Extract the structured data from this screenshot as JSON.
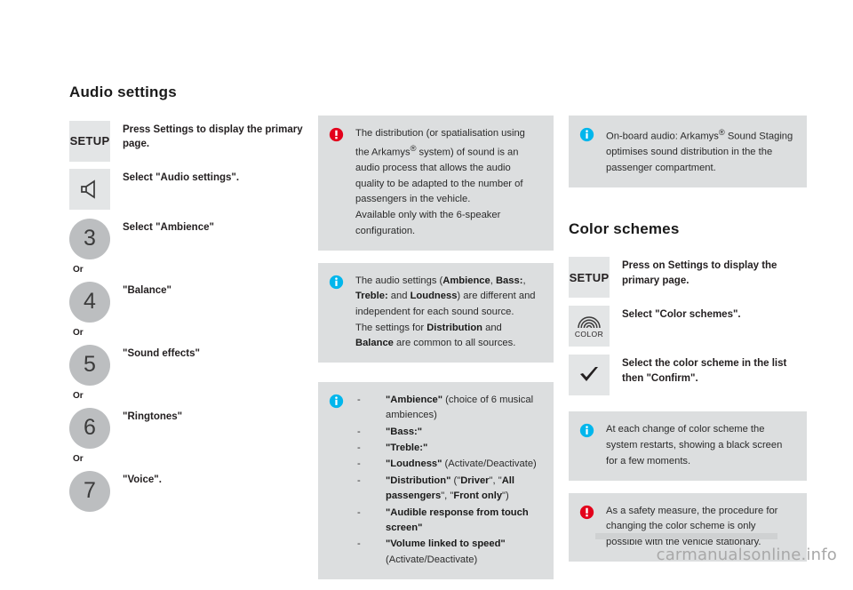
{
  "audio": {
    "title": "Audio settings",
    "steps": [
      {
        "badge_type": "setup",
        "badge_label": "SETUP",
        "icon": "setup-text-icon",
        "text": "Press Settings to display the primary page."
      },
      {
        "badge_type": "icon",
        "badge_label": "",
        "icon": "speaker-icon",
        "text": "Select \"Audio settings\"."
      },
      {
        "badge_type": "number",
        "badge_label": "3",
        "icon": "",
        "text": "Select \"Ambience\""
      },
      {
        "badge_type": "number",
        "badge_label": "4",
        "icon": "",
        "text": "\"Balance\""
      },
      {
        "badge_type": "number",
        "badge_label": "5",
        "icon": "",
        "text": "\"Sound effects\""
      },
      {
        "badge_type": "number",
        "badge_label": "6",
        "icon": "",
        "text": "\"Ringtones\""
      },
      {
        "badge_type": "number",
        "badge_label": "7",
        "icon": "",
        "text": "\"Voice\"."
      }
    ],
    "or_label": "Or"
  },
  "middle_boxes": [
    {
      "kind": "warning",
      "icon": "warning-icon",
      "html": "The distribution (or spatialisation using the Arkamys<sup>&reg;</sup> system) of sound is an audio process that allows the audio quality to be adapted to the number of passengers in the vehicle.<br>Available only with the 6-speaker configuration."
    },
    {
      "kind": "info",
      "icon": "info-icon",
      "html": "The audio settings (<b>Ambience</b>, <b>Bass:</b>, <b>Treble:</b> and <b>Loudness</b>) are different and independent for each sound source.<br>The settings for <b>Distribution</b> and <b>Balance</b> are common to all sources."
    }
  ],
  "settings_list_box": {
    "kind": "info",
    "icon": "info-icon",
    "dash": "-",
    "items": [
      "<b>\"Ambience\"</b> (choice of 6 musical ambiences)",
      "<b>\"Bass:\"</b>",
      "<b>\"Treble:\"</b>",
      "<b>\"Loudness\"</b> (Activate/Deactivate)",
      "<b>\"Distribution\"</b> (\"<b>Driver</b>\", \"<b>All passengers</b>\", \"<b>Front only</b>\")",
      "<b>\"Audible response from touch screen\"</b>",
      "<b>\"Volume linked to speed\"</b> (Activate/Deactivate)"
    ]
  },
  "right": {
    "top_box": {
      "kind": "info",
      "icon": "info-icon",
      "html": "On-board audio: Arkamys<sup>&reg;</sup> Sound Staging optimises sound distribution in the the passenger compartment."
    },
    "title": "Color schemes",
    "steps": [
      {
        "badge_type": "setup",
        "badge_label": "SETUP",
        "icon": "setup-text-icon",
        "text": "Press on Settings to display the primary page."
      },
      {
        "badge_type": "icon",
        "badge_label": "COLOR",
        "icon": "color-rainbow-icon",
        "text": "Select \"Color schemes\"."
      },
      {
        "badge_type": "icon",
        "badge_label": "",
        "icon": "check-icon",
        "text": "Select the color scheme in the list then \"Confirm\"."
      }
    ],
    "boxes": [
      {
        "kind": "info",
        "icon": "info-icon",
        "html": "At each change of color scheme the system restarts, showing a black screen for a few moments."
      },
      {
        "kind": "warning",
        "icon": "warning-icon",
        "html": "As a safety measure, the procedure for changing the color scheme is only possible with the vehicle stationary."
      }
    ]
  },
  "watermark": "carmanualsonline.info",
  "colors": {
    "page_bg": "#ffffff",
    "box_bg": "#dcdedf",
    "tile_bg": "#e3e5e6",
    "circle_bg": "#bcbec0",
    "text": "#231f20",
    "info_blue": "#00b6ec",
    "warning_red": "#e3001b",
    "watermark_grey": "#a8a8a8"
  }
}
